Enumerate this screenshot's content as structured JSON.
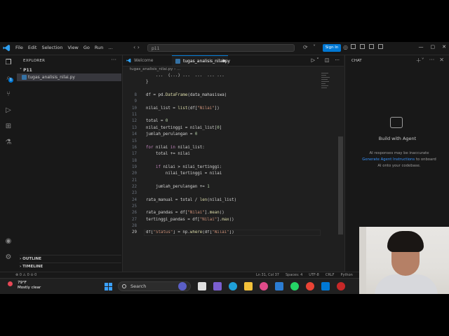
{
  "titlebar": {
    "menu": [
      "File",
      "Edit",
      "Selection",
      "View",
      "Go",
      "Run",
      "…"
    ],
    "search": "p11",
    "signin": "Sign In"
  },
  "sidebar": {
    "title": "EXPLORER",
    "folder": "˅ P11",
    "file": "tugas_analisis_nilai.py",
    "outline": "› OUTLINE",
    "timeline": "› TIMELINE"
  },
  "tabs": [
    {
      "label": "Welcome"
    },
    {
      "label": "tugas_analisis_nilai.py"
    }
  ],
  "breadcrumb": "tugas_analisis_nilai.py › …",
  "code": [
    {
      "n": "",
      "t": "    ...  (...) ...  ...  ... ..."
    },
    {
      "n": "",
      "t": "}"
    },
    {
      "n": "",
      "t": ""
    },
    {
      "n": "8",
      "t": "df = pd.DataFrame(data_mahasiswa)"
    },
    {
      "n": "9",
      "t": ""
    },
    {
      "n": "10",
      "t": "nilai_list = list(df[\"Nilai\"])"
    },
    {
      "n": "11",
      "t": ""
    },
    {
      "n": "12",
      "t": "total = 0"
    },
    {
      "n": "13",
      "t": "nilai_tertinggi = nilai_list[0]"
    },
    {
      "n": "14",
      "t": "jumlah_perulangan = 0"
    },
    {
      "n": "15",
      "t": ""
    },
    {
      "n": "16",
      "t": "for nilai in nilai_list:"
    },
    {
      "n": "17",
      "t": "    total += nilai"
    },
    {
      "n": "18",
      "t": ""
    },
    {
      "n": "19",
      "t": "    if nilai > nilai_tertinggi:"
    },
    {
      "n": "20",
      "t": "        nilai_tertinggi = nilai"
    },
    {
      "n": "21",
      "t": ""
    },
    {
      "n": "22",
      "t": "    jumlah_perulangan += 1"
    },
    {
      "n": "23",
      "t": ""
    },
    {
      "n": "24",
      "t": "rata_manual = total / len(nilai_list)"
    },
    {
      "n": "25",
      "t": ""
    },
    {
      "n": "26",
      "t": "rata_pandas = df[\"Nilai\"].mean()"
    },
    {
      "n": "27",
      "t": "tertinggi_pandas = df[\"Nilai\"].max()"
    },
    {
      "n": "28",
      "t": ""
    },
    {
      "n": "29",
      "t": "df[\"Status\"] = np.where(df[\"Nilai\"])"
    }
  ],
  "chat": {
    "title": "CHAT",
    "agent_title": "Build with Agent",
    "agent_desc_1": "AI responses may be inaccurate",
    "agent_desc_link": "Generate Agent Instructions",
    "agent_desc_2": " to onboard AI onto your codebase."
  },
  "statusbar": {
    "left": "⊗ 0 ⚠ 0   ⊝ 0",
    "position": "Ln 31, Col 37",
    "spaces": "Spaces: 4",
    "encoding": "UTF-8",
    "eol": "CRLF",
    "lang": "Python"
  },
  "taskbar": {
    "weather_temp": "79°F",
    "weather_desc": "Mostly clear",
    "search": "Search"
  },
  "colors": {
    "accent": "#0078d4",
    "editor_bg": "#1f1f1f",
    "keyword": "#c586c0",
    "string": "#ce9178",
    "function": "#dcdcaa",
    "variable": "#9cdcfe",
    "number": "#b5cea8"
  }
}
